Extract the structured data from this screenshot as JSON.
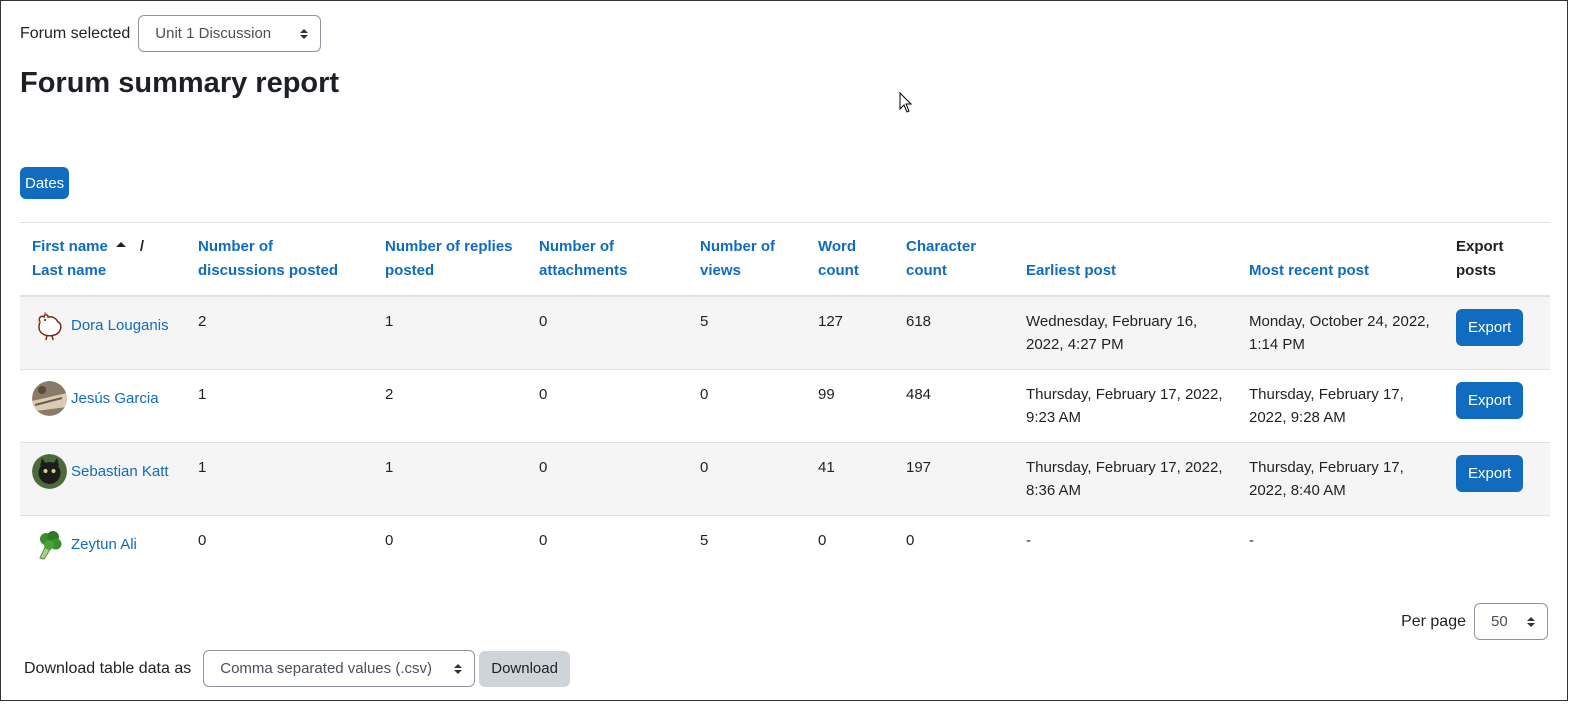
{
  "forum_selector": {
    "label": "Forum selected",
    "value": "Unit 1 Discussion"
  },
  "page_title": "Forum summary report",
  "dates_button": "Dates",
  "table": {
    "headers": {
      "first_name": "First name",
      "last_name": "Last name",
      "discussions": "Number of discussions posted",
      "replies": "Number of replies posted",
      "attachments": "Number of attachments",
      "views": "Number of views",
      "word_count": "Word count",
      "char_count": "Character count",
      "earliest": "Earliest post",
      "recent": "Most recent post",
      "export": "Export posts"
    },
    "export_label": "Export",
    "rows": [
      {
        "name": "Dora Louganis",
        "avatar": "chicken-icon",
        "discussions": "2",
        "replies": "1",
        "attachments": "0",
        "views": "5",
        "words": "127",
        "chars": "618",
        "earliest": "Wednesday, February 16, 2022, 4:27 PM",
        "recent": "Monday, October 24, 2022, 1:14 PM"
      },
      {
        "name": "Jesús Garcia",
        "avatar": "photo-avatar",
        "discussions": "1",
        "replies": "2",
        "attachments": "0",
        "views": "0",
        "words": "99",
        "chars": "484",
        "earliest": "Thursday, February 17, 2022, 9:23 AM",
        "recent": "Thursday, February 17, 2022, 9:28 AM"
      },
      {
        "name": "Sebastian Katt",
        "avatar": "cat-photo-avatar",
        "discussions": "1",
        "replies": "1",
        "attachments": "0",
        "views": "0",
        "words": "41",
        "chars": "197",
        "earliest": "Thursday, February 17, 2022, 8:36 AM",
        "recent": "Thursday, February 17, 2022, 8:40 AM"
      },
      {
        "name": "Zeytun Ali",
        "avatar": "broccoli-icon",
        "discussions": "0",
        "replies": "0",
        "attachments": "0",
        "views": "5",
        "words": "0",
        "chars": "0",
        "earliest": "-",
        "recent": "-"
      }
    ]
  },
  "per_page": {
    "label": "Per page",
    "value": "50"
  },
  "download": {
    "label": "Download table data as",
    "format": "Comma separated values (.csv)",
    "button": "Download"
  },
  "colors": {
    "primary": "#0f6cbf",
    "secondary_button": "#ced4da"
  }
}
